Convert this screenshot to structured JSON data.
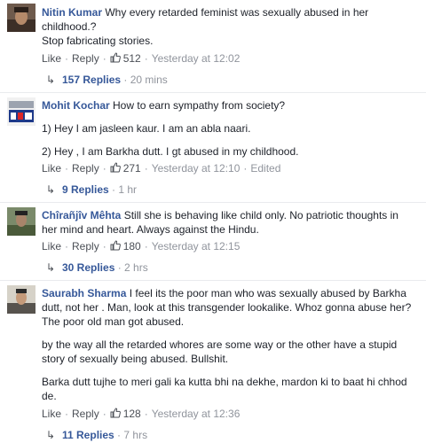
{
  "colors": {
    "link": "#365899",
    "meta": "#90949c",
    "action": "#4b4f56"
  },
  "icons": {
    "like": "thumbs-up-icon",
    "reply_arrow": "reply-arrow-icon"
  },
  "comments": [
    {
      "author": "Nitin Kumar",
      "paragraphs": [
        "Why every retarded feminist was sexually abused in her childhood.?",
        "Stop fabricating stories."
      ],
      "like_label": "Like",
      "reply_label": "Reply",
      "likes": "512",
      "time": "Yesterday at 12:02",
      "edited": "",
      "replies_label": "157 Replies",
      "replies_time": "20 mins"
    },
    {
      "author": "Mohit Kochar",
      "paragraphs": [
        "How to earn sympathy from society?",
        "1) Hey I am jasleen kaur. I am an abla naari.",
        "2) Hey , I am Barkha dutt. I gt abused in my childhood."
      ],
      "like_label": "Like",
      "reply_label": "Reply",
      "likes": "271",
      "time": "Yesterday at 12:10",
      "edited": "Edited",
      "replies_label": "9 Replies",
      "replies_time": "1 hr"
    },
    {
      "author": "Chîrañjîv Mêhta",
      "paragraphs": [
        "Still she is behaving like child only. No patriotic thoughts in her mind and heart. Always against the Hindu."
      ],
      "like_label": "Like",
      "reply_label": "Reply",
      "likes": "180",
      "time": "Yesterday at 12:15",
      "edited": "",
      "replies_label": "30 Replies",
      "replies_time": "2 hrs"
    },
    {
      "author": "Saurabh Sharma",
      "paragraphs": [
        "I feel its the poor man who was sexually abused by Barkha dutt, not her . Man, look at this transgender lookalike. Whoz gonna abuse her? The poor old man got abused.",
        "by the way all the retarded whores are some way or the other have a stupid story of sexually being abused. Bullshit.",
        "Barka dutt tujhe to meri gali ka kutta bhi na dekhe, mardon ki to baat hi chhod de."
      ],
      "like_label": "Like",
      "reply_label": "Reply",
      "likes": "128",
      "time": "Yesterday at 12:36",
      "edited": "",
      "replies_label": "11 Replies",
      "replies_time": "7 hrs"
    }
  ]
}
